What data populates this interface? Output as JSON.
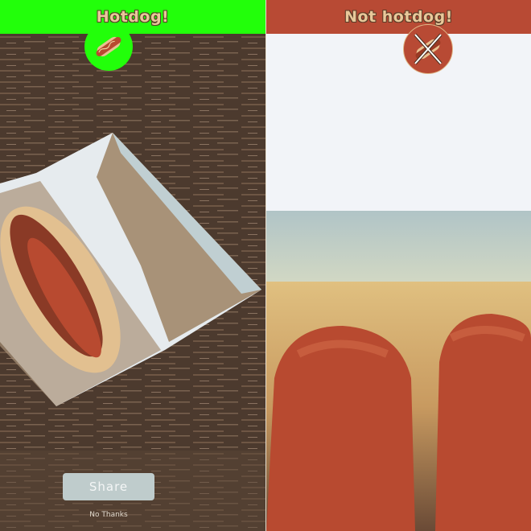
{
  "left_panel": {
    "title": "Hotdog!",
    "header_color": "#22ff0a",
    "badge_icon": "hotdog-icon",
    "share_label": "Share",
    "no_thanks_label": "No Thanks"
  },
  "right_panel": {
    "title": "Not hotdog!",
    "header_color": "#b84a34",
    "badge_icon": "hotdog-crossed-icon"
  }
}
